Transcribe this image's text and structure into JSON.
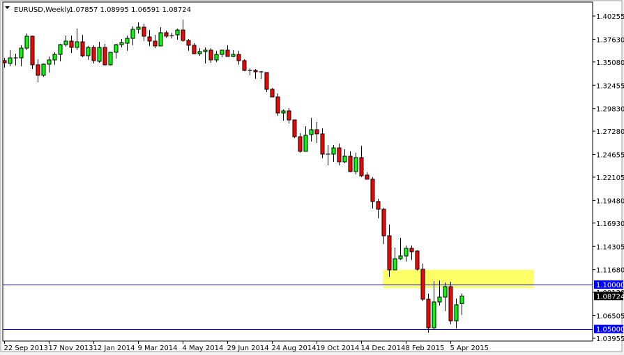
{
  "header": {
    "symbol": "EURUSD,Weekly",
    "ohlc_text": "1.07857 1.08995 1.06591 1.08724",
    "menu_icon": "triangle-down-icon"
  },
  "colors": {
    "bull": "#00ff00",
    "bear": "#ff0000",
    "outline": "#000000",
    "hline": "#0000e6",
    "label_blue": "#0000ff",
    "label_current": "#000000",
    "zone": "#ffff66"
  },
  "chart_data": {
    "type": "candlestick",
    "title": "EURUSD,Weekly",
    "ylim": [
      1.0364,
      1.4206
    ],
    "y_ticks": [
      "1.40255",
      "1.37630",
      "1.35080",
      "1.32455",
      "1.29830",
      "1.27280",
      "1.24655",
      "1.22105",
      "1.19480",
      "1.16930",
      "1.14305",
      "1.11680",
      "1.09130",
      "1.06505",
      "1.03955"
    ],
    "x_labels": [
      {
        "bar": 0,
        "label": "22 Sep 2013"
      },
      {
        "bar": 8,
        "label": "17 Nov 2013"
      },
      {
        "bar": 16,
        "label": "12 Jan 2014"
      },
      {
        "bar": 24,
        "label": "9 Mar 2014"
      },
      {
        "bar": 32,
        "label": "4 May 2014"
      },
      {
        "bar": 40,
        "label": "29 Jun 2014"
      },
      {
        "bar": 48,
        "label": "24 Aug 2014"
      },
      {
        "bar": 56,
        "label": "19 Oct 2014"
      },
      {
        "bar": 64,
        "label": "14 Dec 2014"
      },
      {
        "bar": 72,
        "label": "8 Feb 2015"
      },
      {
        "bar": 80,
        "label": "5 Apr 2015"
      }
    ],
    "horizontal_lines": [
      {
        "price": 1.1,
        "label": "1.10000"
      },
      {
        "price": 1.05,
        "label": "1.05000"
      }
    ],
    "current_price": {
      "price": 1.08724,
      "label": "1.08724"
    },
    "zone": {
      "from_bar": 68,
      "to_bar": 95,
      "price_low": 1.0961,
      "price_high": 1.1166
    },
    "ohlc": [
      [
        1.3523,
        1.3554,
        1.3444,
        1.3499
      ],
      [
        1.3491,
        1.3641,
        1.346,
        1.3554
      ],
      [
        1.3546,
        1.3601,
        1.3468,
        1.3554
      ],
      [
        1.3554,
        1.3696,
        1.346,
        1.3664
      ],
      [
        1.3664,
        1.3829,
        1.3641,
        1.3798
      ],
      [
        1.3798,
        1.3805,
        1.3428,
        1.3476
      ],
      [
        1.3476,
        1.3538,
        1.3279,
        1.3358
      ],
      [
        1.3358,
        1.3491,
        1.3342,
        1.3483
      ],
      [
        1.3483,
        1.357,
        1.3389,
        1.3531
      ],
      [
        1.3531,
        1.3617,
        1.3476,
        1.3593
      ],
      [
        1.3593,
        1.3711,
        1.3515,
        1.3703
      ],
      [
        1.3703,
        1.3805,
        1.368,
        1.3743
      ],
      [
        1.3743,
        1.3805,
        1.3609,
        1.3672
      ],
      [
        1.3672,
        1.3884,
        1.3641,
        1.3735
      ],
      [
        1.3735,
        1.3813,
        1.3562,
        1.3578
      ],
      [
        1.3578,
        1.3688,
        1.3531,
        1.3672
      ],
      [
        1.3672,
        1.3696,
        1.3491,
        1.3523
      ],
      [
        1.3515,
        1.3735,
        1.3499,
        1.3672
      ],
      [
        1.3672,
        1.3711,
        1.3468,
        1.3476
      ],
      [
        1.3476,
        1.3617,
        1.3468,
        1.3617
      ],
      [
        1.3617,
        1.3711,
        1.3546,
        1.3703
      ],
      [
        1.3703,
        1.3766,
        1.3672,
        1.3727
      ],
      [
        1.3719,
        1.3805,
        1.3633,
        1.3774
      ],
      [
        1.3774,
        1.3908,
        1.3696,
        1.3876
      ],
      [
        1.3876,
        1.3955,
        1.3829,
        1.39
      ],
      [
        1.39,
        1.3939,
        1.3743,
        1.3798
      ],
      [
        1.379,
        1.3868,
        1.3688,
        1.3743
      ],
      [
        1.3743,
        1.3813,
        1.3664,
        1.3688
      ],
      [
        1.3688,
        1.39,
        1.3688,
        1.3837
      ],
      [
        1.3837,
        1.386,
        1.3782,
        1.3798
      ],
      [
        1.3805,
        1.3837,
        1.3774,
        1.3805
      ],
      [
        1.3813,
        1.3884,
        1.3758,
        1.3868
      ],
      [
        1.3868,
        1.3986,
        1.3735,
        1.375
      ],
      [
        1.375,
        1.3766,
        1.3633,
        1.3696
      ],
      [
        1.3696,
        1.3719,
        1.3601,
        1.3601
      ],
      [
        1.3601,
        1.3664,
        1.3578,
        1.3625
      ],
      [
        1.3625,
        1.3672,
        1.3491,
        1.3641
      ],
      [
        1.3641,
        1.3664,
        1.3499,
        1.3531
      ],
      [
        1.3531,
        1.3633,
        1.3507,
        1.3593
      ],
      [
        1.3593,
        1.3641,
        1.3562,
        1.3641
      ],
      [
        1.3641,
        1.3696,
        1.357,
        1.357
      ],
      [
        1.357,
        1.3641,
        1.3562,
        1.3593
      ],
      [
        1.3593,
        1.3633,
        1.3476,
        1.3523
      ],
      [
        1.3523,
        1.3538,
        1.3405,
        1.3413
      ],
      [
        1.3413,
        1.3436,
        1.3358,
        1.3413
      ],
      [
        1.3413,
        1.3428,
        1.3318,
        1.3397
      ],
      [
        1.3397,
        1.3405,
        1.3318,
        1.3397
      ],
      [
        1.3389,
        1.3389,
        1.3169,
        1.32
      ],
      [
        1.32,
        1.3216,
        1.3114,
        1.3114
      ],
      [
        1.3114,
        1.3153,
        1.2902,
        1.2933
      ],
      [
        1.2933,
        1.2973,
        1.2847,
        1.2957
      ],
      [
        1.2957,
        1.2988,
        1.2815,
        1.2855
      ],
      [
        1.2855,
        1.2855,
        1.265,
        1.2666
      ],
      [
        1.2666,
        1.2705,
        1.2486,
        1.2501
      ],
      [
        1.2501,
        1.2784,
        1.2501,
        1.2682
      ],
      [
        1.269,
        1.2878,
        1.2611,
        1.2745
      ],
      [
        1.2745,
        1.2831,
        1.2595,
        1.2698
      ],
      [
        1.2698,
        1.276,
        1.2423,
        1.247
      ],
      [
        1.247,
        1.2572,
        1.2344,
        1.247
      ],
      [
        1.247,
        1.2572,
        1.2383,
        1.254
      ],
      [
        1.254,
        1.2588,
        1.2344,
        1.2383
      ],
      [
        1.2383,
        1.2525,
        1.2368,
        1.2446
      ],
      [
        1.2446,
        1.2501,
        1.2266,
        1.2273
      ],
      [
        1.2273,
        1.2486,
        1.2242,
        1.2431
      ],
      [
        1.2431,
        1.2564,
        1.2211,
        1.2226
      ],
      [
        1.2234,
        1.2266,
        1.2187,
        1.2187
      ],
      [
        1.2187,
        1.2211,
        1.1857,
        1.1936
      ],
      [
        1.1936,
        1.1967,
        1.1747,
        1.1849
      ],
      [
        1.1849,
        1.1865,
        1.1456,
        1.155
      ],
      [
        1.155,
        1.1676,
        1.1087,
        1.1166
      ],
      [
        1.1166,
        1.1417,
        1.1166,
        1.1291
      ],
      [
        1.1291,
        1.1527,
        1.1276,
        1.1323
      ],
      [
        1.1323,
        1.1441,
        1.126,
        1.1409
      ],
      [
        1.1409,
        1.1441,
        1.1276,
        1.137
      ],
      [
        1.1378,
        1.1386,
        1.1158,
        1.1173
      ],
      [
        1.1173,
        1.1236,
        1.0812,
        1.0835
      ],
      [
        1.0835,
        1.0898,
        1.0458,
        1.0513
      ],
      [
        1.0513,
        1.104,
        1.049,
        1.0804
      ],
      [
        1.0804,
        1.1048,
        1.0765,
        1.0859
      ],
      [
        1.0859,
        1.1024,
        1.0702,
        1.0977
      ],
      [
        1.0977,
        1.1032,
        1.0553,
        1.0592
      ],
      [
        1.0592,
        1.0843,
        1.0506,
        1.0773
      ],
      [
        1.07857,
        1.08995,
        1.06591,
        1.08724
      ]
    ]
  }
}
